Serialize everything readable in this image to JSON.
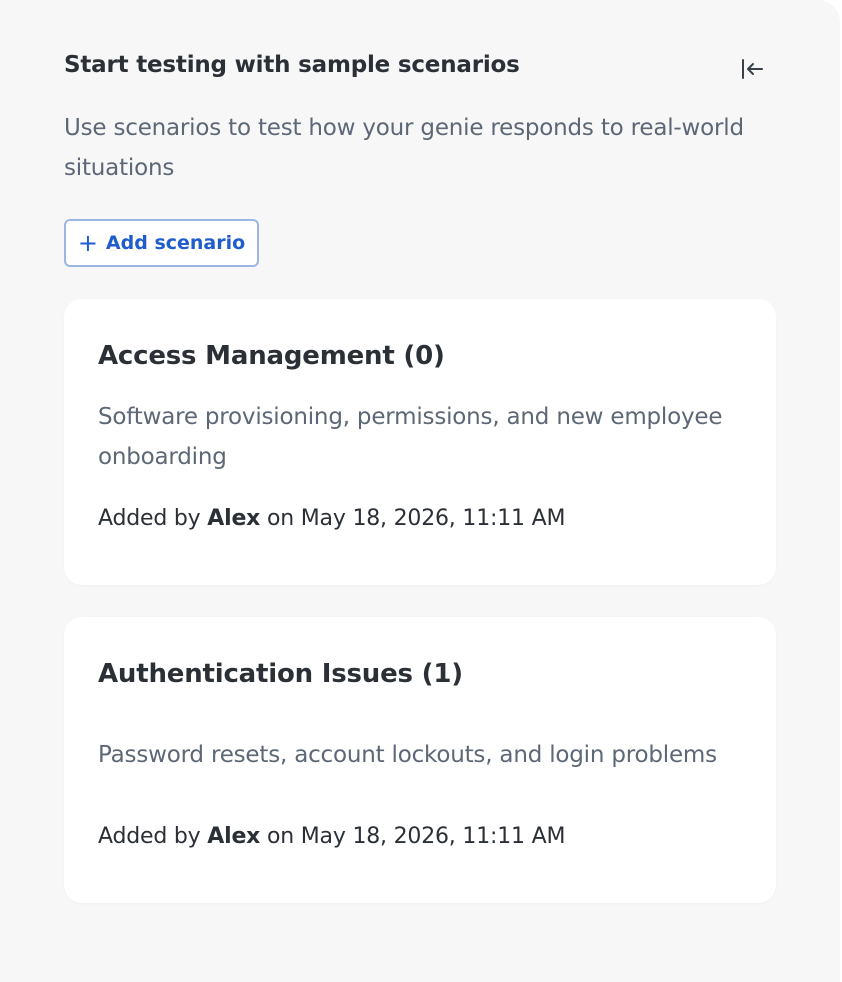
{
  "panel": {
    "title": "Start testing with sample scenarios",
    "description": "Use scenarios to test how your genie responds to real-world situations",
    "collapse_icon": "collapse-left-icon",
    "add_button": {
      "plus_glyph": "+",
      "label": "Add scenario"
    }
  },
  "scenarios": [
    {
      "title": "Access Management (0)",
      "description": "Software provisioning, permissions, and new employee onboarding",
      "meta_prefix": "Added by",
      "author": "Alex",
      "meta_suffix": "on May 18, 2026, 11:11 AM"
    },
    {
      "title": "Authentication Issues (1)",
      "description": "Password resets, account lockouts, and login problems",
      "meta_prefix": "Added by",
      "author": "Alex",
      "meta_suffix": "on May 18, 2026, 11:11 AM"
    }
  ],
  "colors": {
    "panel_bg": "#f7f7f8",
    "card_bg": "#ffffff",
    "heading": "#2b3037",
    "muted_text": "#5d6776",
    "accent": "#1f5ccc",
    "button_border": "#9cb6e4"
  }
}
